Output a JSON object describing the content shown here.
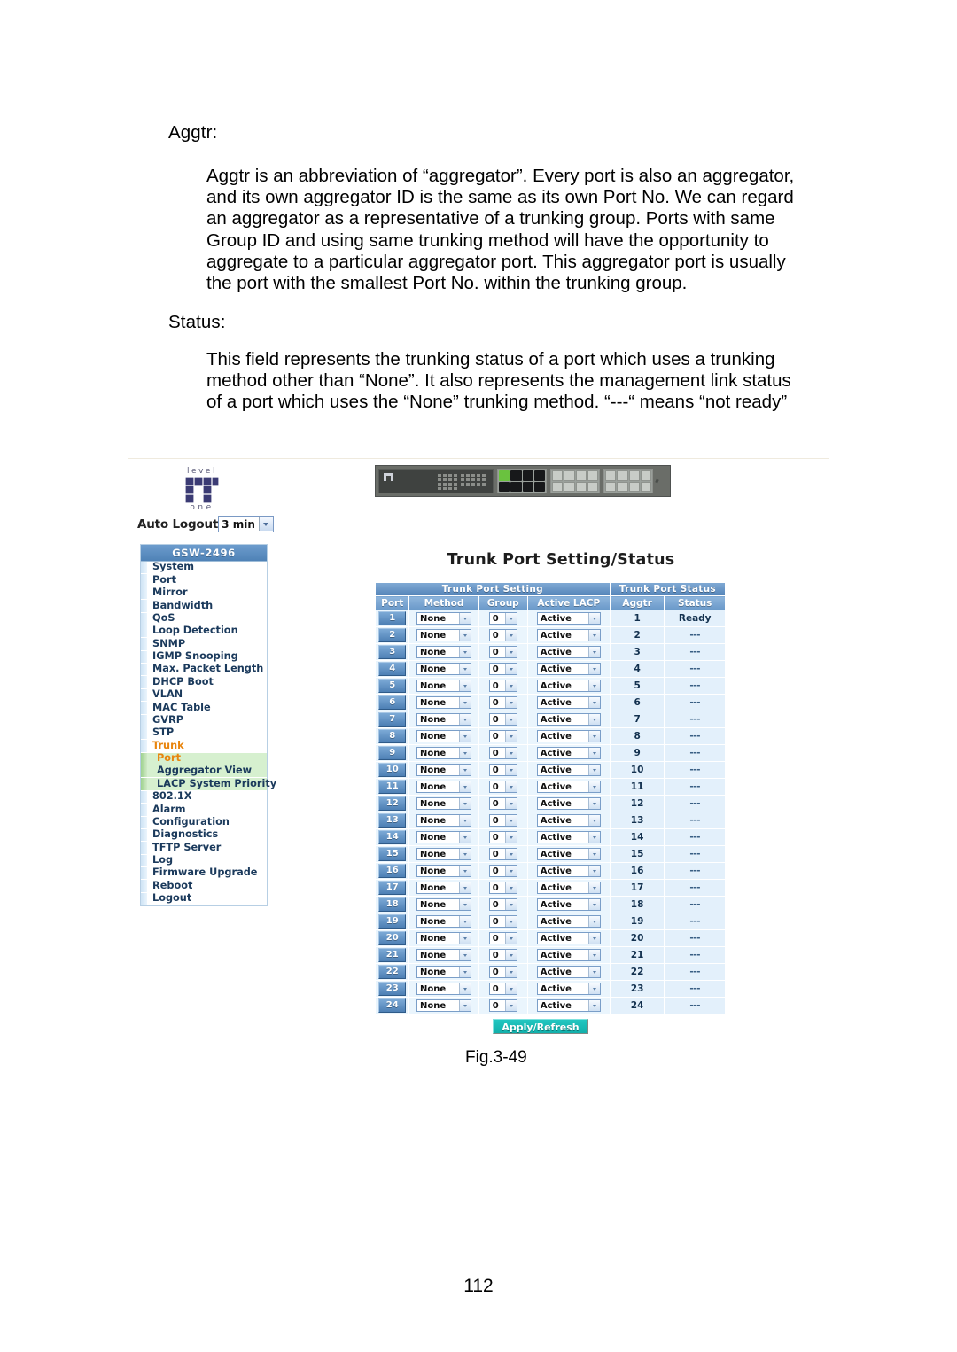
{
  "document": {
    "sections": [
      {
        "term": "Aggtr:",
        "lines": [
          "Aggtr is an abbreviation of “aggregator”. Every port is also an aggregator,",
          "and its own aggregator ID is the same as its own Port No. We can regard",
          "an  aggregator  as  a  representative  of  a  trunking  group.  Ports  with  same",
          "Group  ID  and  using  same  trunking  method  will  have  the  opportunity  to",
          "aggregate  to  a  particular  aggregator  port.  This  aggregator  port  is  usually",
          "the port with the smallest Port No. within the trunking group."
        ]
      },
      {
        "term": "Status:",
        "lines": [
          "This  field  represents  the  trunking  status  of  a  port  which  uses  a  trunking",
          "method other than “None”. It also represents the management link status",
          "of a port which uses the “None” trunking method. “---“ means “not ready”"
        ]
      }
    ],
    "figure_caption": "Fig.3-49",
    "page_number": "112"
  },
  "screenshot": {
    "brand": {
      "top_word": "level",
      "bottom_word": "one"
    },
    "auto_logout": {
      "label": "Auto Logout",
      "value": "3 min"
    },
    "menu": {
      "title": "GSW-2496",
      "items": [
        {
          "label": "System",
          "level": 0,
          "state": "normal"
        },
        {
          "label": "Port",
          "level": 0,
          "state": "normal"
        },
        {
          "label": "Mirror",
          "level": 0,
          "state": "normal"
        },
        {
          "label": "Bandwidth",
          "level": 0,
          "state": "normal"
        },
        {
          "label": "QoS",
          "level": 0,
          "state": "normal"
        },
        {
          "label": "Loop Detection",
          "level": 0,
          "state": "normal"
        },
        {
          "label": "SNMP",
          "level": 0,
          "state": "normal"
        },
        {
          "label": "IGMP Snooping",
          "level": 0,
          "state": "normal"
        },
        {
          "label": "Max. Packet Length",
          "level": 0,
          "state": "normal"
        },
        {
          "label": "DHCP Boot",
          "level": 0,
          "state": "normal"
        },
        {
          "label": "VLAN",
          "level": 0,
          "state": "normal"
        },
        {
          "label": "MAC Table",
          "level": 0,
          "state": "normal"
        },
        {
          "label": "GVRP",
          "level": 0,
          "state": "normal"
        },
        {
          "label": "STP",
          "level": 0,
          "state": "normal"
        },
        {
          "label": "Trunk",
          "level": 0,
          "state": "expanded"
        },
        {
          "label": "Port",
          "level": 1,
          "state": "active"
        },
        {
          "label": "Aggregator View",
          "level": 1,
          "state": "normal"
        },
        {
          "label": "LACP System Priority",
          "level": 1,
          "state": "normal"
        },
        {
          "label": "802.1X",
          "level": 0,
          "state": "normal"
        },
        {
          "label": "Alarm",
          "level": 0,
          "state": "normal"
        },
        {
          "label": "Configuration",
          "level": 0,
          "state": "normal"
        },
        {
          "label": "Diagnostics",
          "level": 0,
          "state": "normal"
        },
        {
          "label": "TFTP Server",
          "level": 0,
          "state": "normal"
        },
        {
          "label": "Log",
          "level": 0,
          "state": "normal"
        },
        {
          "label": "Firmware Upgrade",
          "level": 0,
          "state": "normal"
        },
        {
          "label": "Reboot",
          "level": 0,
          "state": "normal"
        },
        {
          "label": "Logout",
          "level": 0,
          "state": "normal"
        }
      ]
    },
    "page_heading": "Trunk Port Setting/Status",
    "table": {
      "group_headers": [
        {
          "label": "Trunk Port Setting",
          "colspan": 4
        },
        {
          "label": "Trunk Port Status",
          "colspan": 2
        }
      ],
      "columns": [
        "Port",
        "Method",
        "Group",
        "Active LACP",
        "Aggtr",
        "Status"
      ],
      "rows": [
        {
          "port": "1",
          "method": "None",
          "group": "0",
          "lacp": "Active",
          "aggtr": "1",
          "status": "Ready"
        },
        {
          "port": "2",
          "method": "None",
          "group": "0",
          "lacp": "Active",
          "aggtr": "2",
          "status": "---"
        },
        {
          "port": "3",
          "method": "None",
          "group": "0",
          "lacp": "Active",
          "aggtr": "3",
          "status": "---"
        },
        {
          "port": "4",
          "method": "None",
          "group": "0",
          "lacp": "Active",
          "aggtr": "4",
          "status": "---"
        },
        {
          "port": "5",
          "method": "None",
          "group": "0",
          "lacp": "Active",
          "aggtr": "5",
          "status": "---"
        },
        {
          "port": "6",
          "method": "None",
          "group": "0",
          "lacp": "Active",
          "aggtr": "6",
          "status": "---"
        },
        {
          "port": "7",
          "method": "None",
          "group": "0",
          "lacp": "Active",
          "aggtr": "7",
          "status": "---"
        },
        {
          "port": "8",
          "method": "None",
          "group": "0",
          "lacp": "Active",
          "aggtr": "8",
          "status": "---"
        },
        {
          "port": "9",
          "method": "None",
          "group": "0",
          "lacp": "Active",
          "aggtr": "9",
          "status": "---"
        },
        {
          "port": "10",
          "method": "None",
          "group": "0",
          "lacp": "Active",
          "aggtr": "10",
          "status": "---"
        },
        {
          "port": "11",
          "method": "None",
          "group": "0",
          "lacp": "Active",
          "aggtr": "11",
          "status": "---"
        },
        {
          "port": "12",
          "method": "None",
          "group": "0",
          "lacp": "Active",
          "aggtr": "12",
          "status": "---"
        },
        {
          "port": "13",
          "method": "None",
          "group": "0",
          "lacp": "Active",
          "aggtr": "13",
          "status": "---"
        },
        {
          "port": "14",
          "method": "None",
          "group": "0",
          "lacp": "Active",
          "aggtr": "14",
          "status": "---"
        },
        {
          "port": "15",
          "method": "None",
          "group": "0",
          "lacp": "Active",
          "aggtr": "15",
          "status": "---"
        },
        {
          "port": "16",
          "method": "None",
          "group": "0",
          "lacp": "Active",
          "aggtr": "16",
          "status": "---"
        },
        {
          "port": "17",
          "method": "None",
          "group": "0",
          "lacp": "Active",
          "aggtr": "17",
          "status": "---"
        },
        {
          "port": "18",
          "method": "None",
          "group": "0",
          "lacp": "Active",
          "aggtr": "18",
          "status": "---"
        },
        {
          "port": "19",
          "method": "None",
          "group": "0",
          "lacp": "Active",
          "aggtr": "19",
          "status": "---"
        },
        {
          "port": "20",
          "method": "None",
          "group": "0",
          "lacp": "Active",
          "aggtr": "20",
          "status": "---"
        },
        {
          "port": "21",
          "method": "None",
          "group": "0",
          "lacp": "Active",
          "aggtr": "21",
          "status": "---"
        },
        {
          "port": "22",
          "method": "None",
          "group": "0",
          "lacp": "Active",
          "aggtr": "22",
          "status": "---"
        },
        {
          "port": "23",
          "method": "None",
          "group": "0",
          "lacp": "Active",
          "aggtr": "23",
          "status": "---"
        },
        {
          "port": "24",
          "method": "None",
          "group": "0",
          "lacp": "Active",
          "aggtr": "24",
          "status": "---"
        }
      ]
    },
    "apply_button": "Apply/Refresh",
    "colors": {
      "header_blue": "#5585b9",
      "row_blue": "#ddeefb",
      "submenu_green": "#d6f0cf",
      "active_orange": "#e8850e",
      "apply_teal": "#11b0ab"
    }
  }
}
